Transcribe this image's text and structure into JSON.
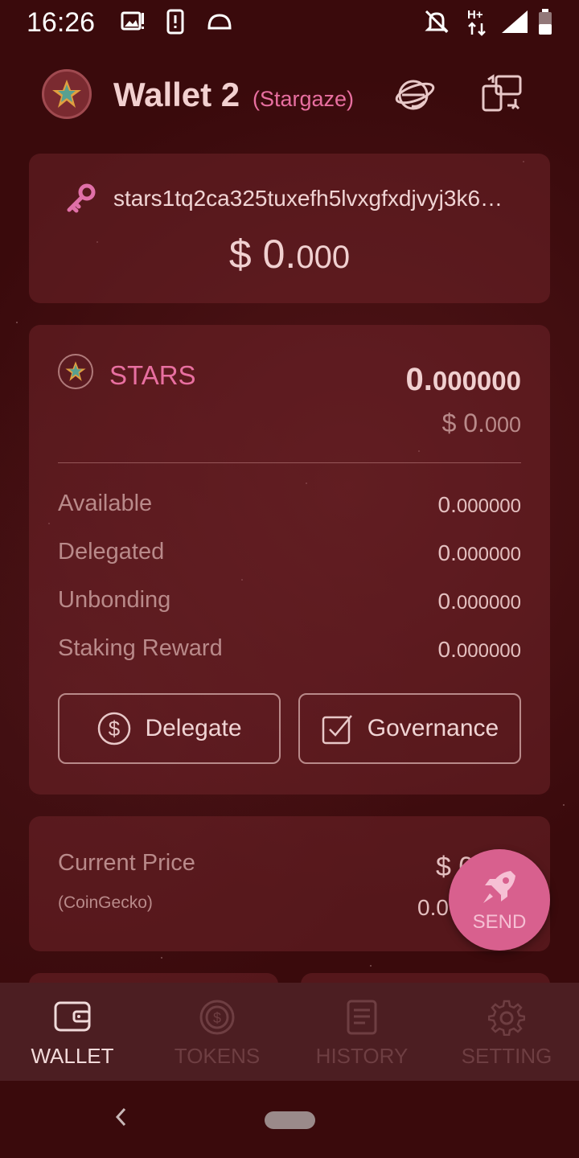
{
  "status_bar": {
    "time": "16:26",
    "network": "H+"
  },
  "header": {
    "wallet_name": "Wallet 2",
    "chain_name": "(Stargaze)"
  },
  "address_card": {
    "address": "stars1tq2ca325tuxefh5lvxgfxdjvyj3k6…",
    "total_prefix": "$ 0.",
    "total_decimals": "000"
  },
  "token_card": {
    "symbol": "STARS",
    "amount_int": "0.",
    "amount_dec": "000000",
    "usd_int": "$ 0.",
    "usd_dec": "000",
    "rows": [
      {
        "label": "Available",
        "value_int": "0.",
        "value_dec": "000000"
      },
      {
        "label": "Delegated",
        "value_int": "0.",
        "value_dec": "000000"
      },
      {
        "label": "Unbonding",
        "value_int": "0.",
        "value_dec": "000000"
      },
      {
        "label": "Staking Reward",
        "value_int": "0.",
        "value_dec": "000000"
      }
    ],
    "delegate_label": "Delegate",
    "governance_label": "Governance"
  },
  "price_card": {
    "label": "Current Price",
    "source": "(CoinGecko)",
    "price": "$ 0",
    "change": "0.0"
  },
  "fab": {
    "label": "SEND"
  },
  "bottom_nav": {
    "items": [
      {
        "label": "WALLET",
        "icon": "wallet-icon"
      },
      {
        "label": "TOKENS",
        "icon": "coin-icon"
      },
      {
        "label": "HISTORY",
        "icon": "document-icon"
      },
      {
        "label": "SETTING",
        "icon": "gear-icon"
      }
    ],
    "active_index": 0
  },
  "colors": {
    "background": "#3a0a0c",
    "accent_pink": "#e86fa0",
    "fab": "#d8608e",
    "nav_bg": "#4c1e22"
  }
}
